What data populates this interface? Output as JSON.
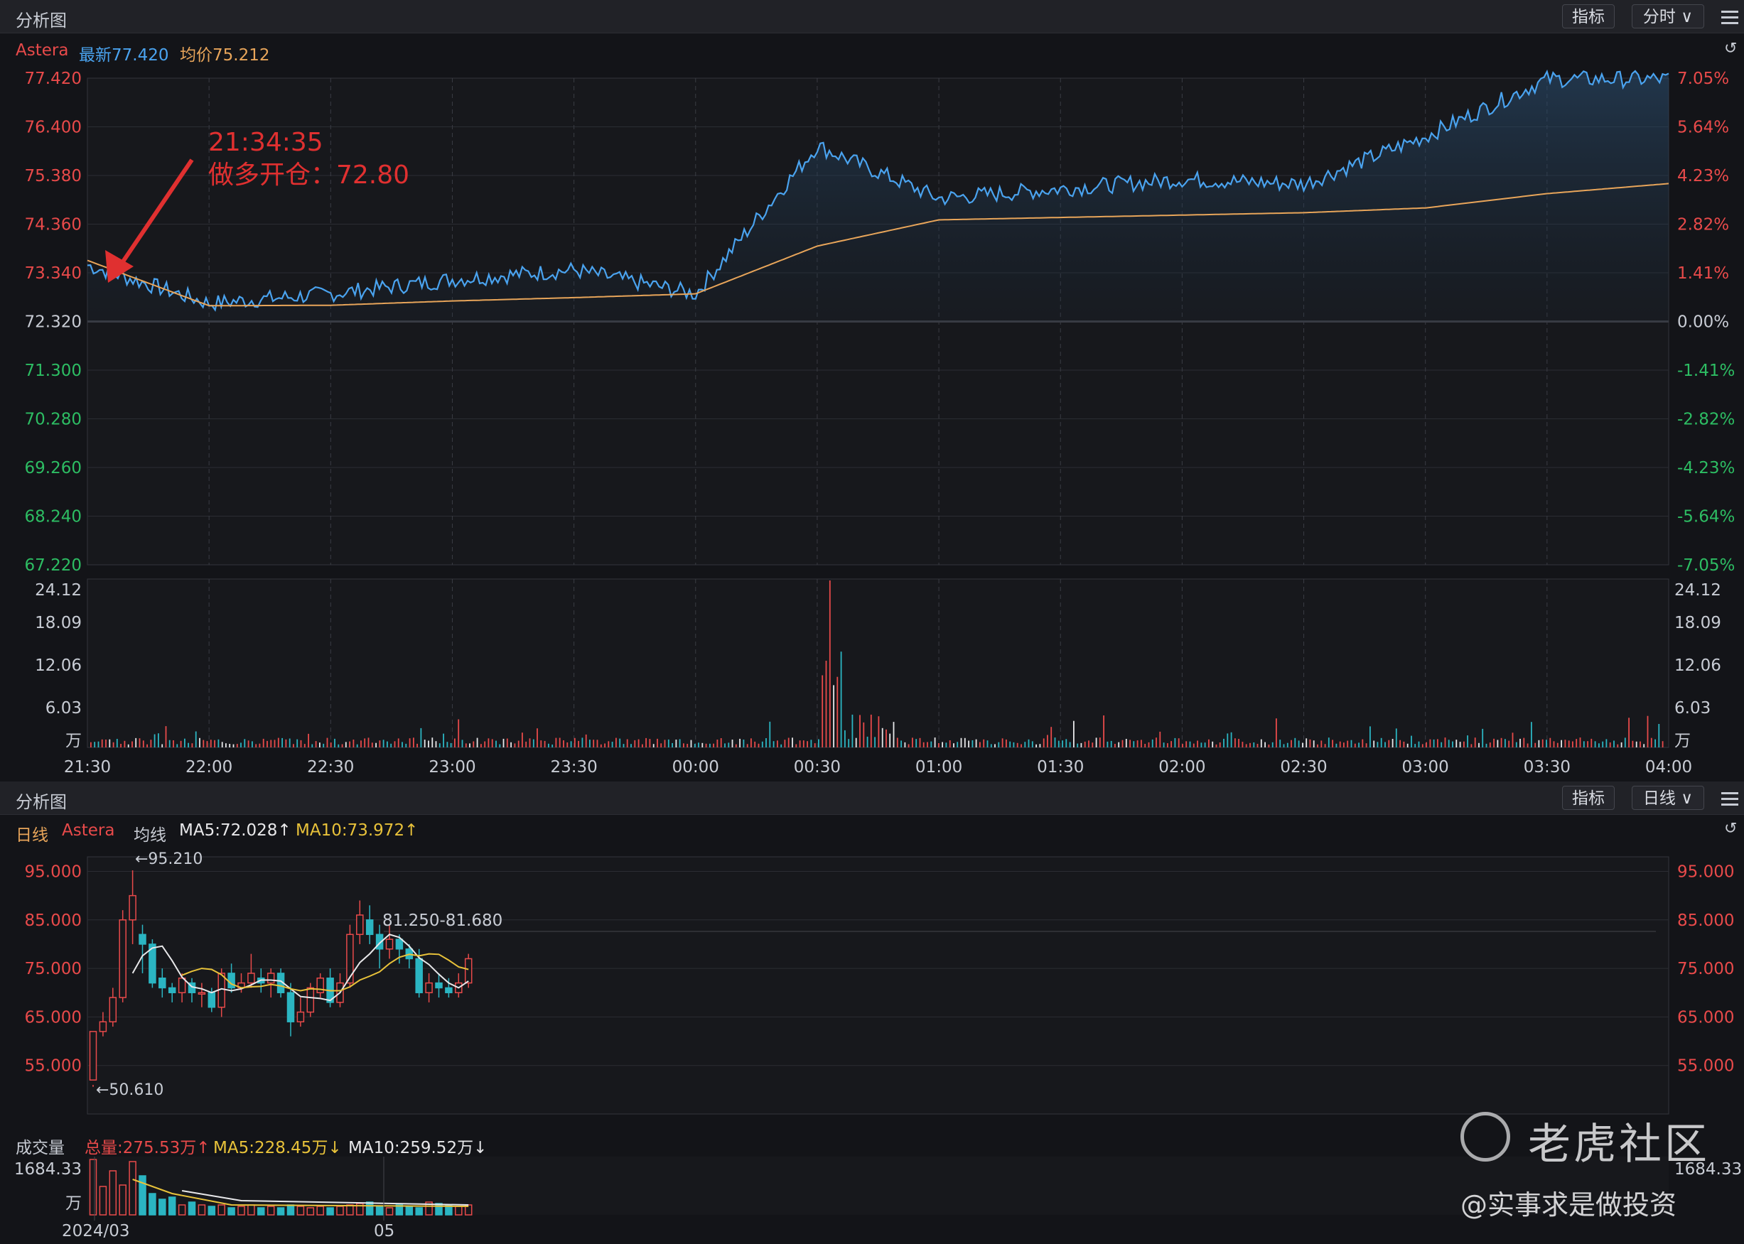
{
  "top_panel": {
    "title": "分析图",
    "indicator_button": "指标",
    "period_dropdown": "分时 ∨",
    "info": {
      "name": "Astera",
      "latest": "最新77.420",
      "avg": "均价75.212"
    },
    "price_ticks": [
      "77.420",
      "76.400",
      "75.380",
      "74.360",
      "73.340",
      "72.320",
      "71.300",
      "70.280",
      "69.260",
      "68.240",
      "67.220"
    ],
    "pct_ticks": [
      "7.05%",
      "5.64%",
      "4.23%",
      "2.82%",
      "1.41%",
      "0.00%",
      "-1.41%",
      "-2.82%",
      "-4.23%",
      "-5.64%",
      "-7.05%"
    ],
    "vol_ticks": [
      "24.12",
      "18.09",
      "12.06",
      "6.03",
      "万"
    ],
    "time_ticks": [
      "21:30",
      "22:00",
      "22:30",
      "23:00",
      "23:30",
      "00:00",
      "00:30",
      "01:00",
      "01:30",
      "02:00",
      "02:30",
      "03:00",
      "03:30",
      "04:00"
    ],
    "annotation": {
      "time": "21:34:35",
      "text": "做多开仓：72.80"
    },
    "colors": {
      "price_line": "#4aa3ef",
      "avg_line": "#e8a55a",
      "up": "#e84a4a",
      "down": "#2dbd63"
    }
  },
  "bottom_panel": {
    "title": "分析图",
    "indicator_button": "指标",
    "period_dropdown": "日线 ∨",
    "info": {
      "period": "日线",
      "name": "Astera",
      "type": "均线",
      "ma5": "MA5:72.028↑",
      "ma10": "MA10:73.972↑"
    },
    "price_ticks": [
      "95.000",
      "85.000",
      "75.000",
      "65.000",
      "55.000"
    ],
    "high_label": "←95.210",
    "low_label": "←50.610",
    "range_label": "81.250-81.680",
    "volume": {
      "label": "成交量",
      "total": "总量:275.53万↑",
      "ma5": "MA5:228.45万↓",
      "ma10": "MA10:259.52万↓",
      "tick": "1684.33",
      "unit": "万"
    },
    "date_ticks": [
      "2024/03",
      "05"
    ]
  },
  "watermark": {
    "brand": "老虎社区",
    "author": "@实事求是做投资"
  },
  "chart_data": [
    {
      "type": "line",
      "name": "intraday",
      "x": [
        "21:30",
        "22:00",
        "22:30",
        "23:00",
        "23:30",
        "00:00",
        "00:30",
        "01:00",
        "01:30",
        "02:00",
        "02:30",
        "03:00",
        "03:30",
        "04:00"
      ],
      "series": [
        {
          "name": "最新",
          "values": [
            73.5,
            72.7,
            72.9,
            73.2,
            73.4,
            72.9,
            76.0,
            74.9,
            75.1,
            75.3,
            75.2,
            76.2,
            77.4,
            77.4
          ]
        },
        {
          "name": "均价",
          "values": [
            73.6,
            72.65,
            72.66,
            72.75,
            72.82,
            72.9,
            73.9,
            74.45,
            74.5,
            74.55,
            74.6,
            74.7,
            75.0,
            75.21
          ]
        }
      ],
      "ylim": [
        67.22,
        77.42
      ]
    },
    {
      "type": "bar",
      "name": "daily-candles",
      "description_units": "price",
      "ohlc": [
        [
          52,
          62,
          51,
          50.6
        ],
        [
          62,
          64,
          66,
          61
        ],
        [
          64,
          69,
          71,
          63
        ],
        [
          69,
          85,
          87,
          68
        ],
        [
          85,
          90,
          95.21,
          80
        ],
        [
          82,
          80,
          84,
          74
        ],
        [
          80,
          72,
          81,
          71
        ],
        [
          73,
          71,
          75,
          69
        ],
        [
          71,
          70,
          72,
          68
        ],
        [
          70,
          73,
          74,
          68
        ],
        [
          72,
          70,
          73,
          68
        ],
        [
          70,
          70,
          72,
          67
        ],
        [
          70,
          67,
          71,
          66
        ],
        [
          67,
          74,
          75,
          65
        ],
        [
          74,
          71,
          76,
          70
        ],
        [
          71,
          72,
          74,
          70
        ],
        [
          72,
          74,
          78,
          71
        ],
        [
          73,
          72,
          75,
          70
        ],
        [
          72,
          74,
          75,
          69
        ],
        [
          74,
          70,
          75,
          69
        ],
        [
          70,
          64,
          72,
          61
        ],
        [
          64,
          66,
          69,
          63
        ],
        [
          66,
          71,
          72,
          65
        ],
        [
          70,
          73,
          74,
          69
        ],
        [
          73,
          68,
          75,
          67
        ],
        [
          68,
          72,
          74,
          67
        ],
        [
          72,
          82,
          84,
          71
        ],
        [
          82,
          86,
          89,
          80
        ],
        [
          85,
          82,
          88,
          80
        ],
        [
          82,
          79,
          84,
          75
        ],
        [
          79,
          81,
          84,
          77
        ],
        [
          81,
          79,
          82,
          76
        ],
        [
          79,
          77,
          80,
          75
        ],
        [
          77,
          70,
          79,
          69
        ],
        [
          70,
          72,
          74,
          68
        ],
        [
          72,
          71,
          74,
          69
        ],
        [
          71,
          70,
          73,
          69
        ],
        [
          70,
          72,
          74,
          69
        ],
        [
          72,
          77,
          78,
          71
        ]
      ]
    }
  ]
}
